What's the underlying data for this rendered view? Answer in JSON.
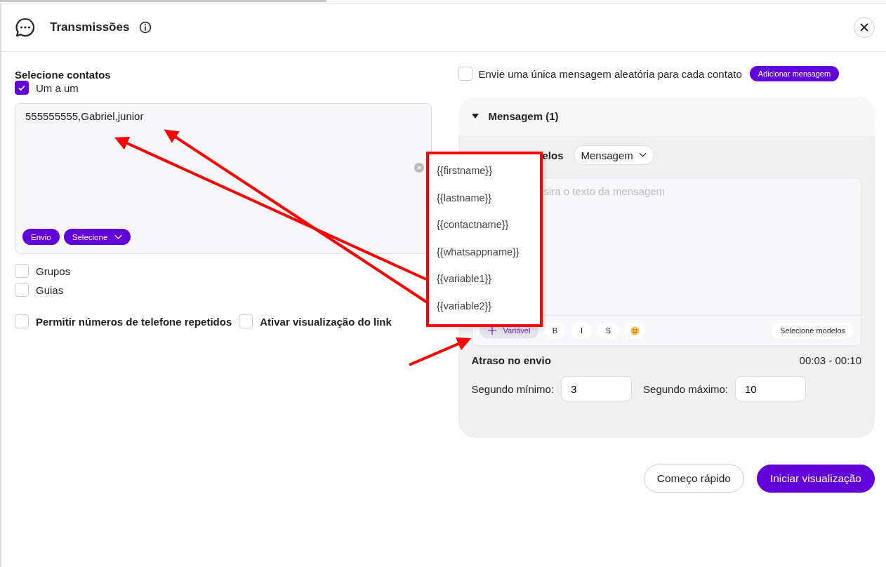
{
  "header": {
    "title": "Transmissões"
  },
  "contacts": {
    "label": "Selecione contatos",
    "one_by_one": {
      "label": "Um a um",
      "checked": true
    },
    "value": "555555555,Gabriel,junior",
    "buttons": [
      {
        "label": "Envio",
        "kind": "plain"
      },
      {
        "label": "Selecione",
        "kind": "dropdown"
      }
    ]
  },
  "options": [
    {
      "label": "Grupos",
      "checked": false
    },
    {
      "label": "Guias",
      "checked": false
    }
  ],
  "settings": [
    {
      "label": "Permitir números de telefone repetidos",
      "checked": false
    },
    {
      "label": "Ativar visualização do link",
      "checked": false
    }
  ],
  "random_message": {
    "label": "Envie uma única mensagem aleatória para cada contato",
    "checked": false,
    "button": "Adicionar mensagem"
  },
  "message_panel": {
    "title": "Mensagem (1)",
    "expanded": true,
    "template_label_visible": "elos",
    "template_select": "Mensagem",
    "placeholder": "sira o texto da mensagem",
    "toolbar": [
      {
        "label": "Variável",
        "kind": "add"
      },
      {
        "label": "B",
        "kind": "format"
      },
      {
        "label": "I",
        "kind": "format"
      },
      {
        "label": "S",
        "kind": "format"
      },
      {
        "kind": "emoji"
      }
    ],
    "select_templates": "Selecione modelos"
  },
  "delay": {
    "label": "Atraso no envio",
    "range": "00:03 - 00:10",
    "min_label": "Segundo mínimo:",
    "min_value": "3",
    "max_label": "Segundo máximo:",
    "max_value": "10"
  },
  "variable_menu": {
    "items": [
      "{{firstname}}",
      "{{lastname}}",
      "{{contactname}}",
      "{{whatsappname}}",
      "{{variable1}}",
      "{{variable2}}"
    ]
  },
  "footer_buttons": [
    {
      "label": "Começo rápido",
      "kind": "secondary"
    },
    {
      "label": "Iniciar visualização",
      "kind": "primary"
    }
  ]
}
